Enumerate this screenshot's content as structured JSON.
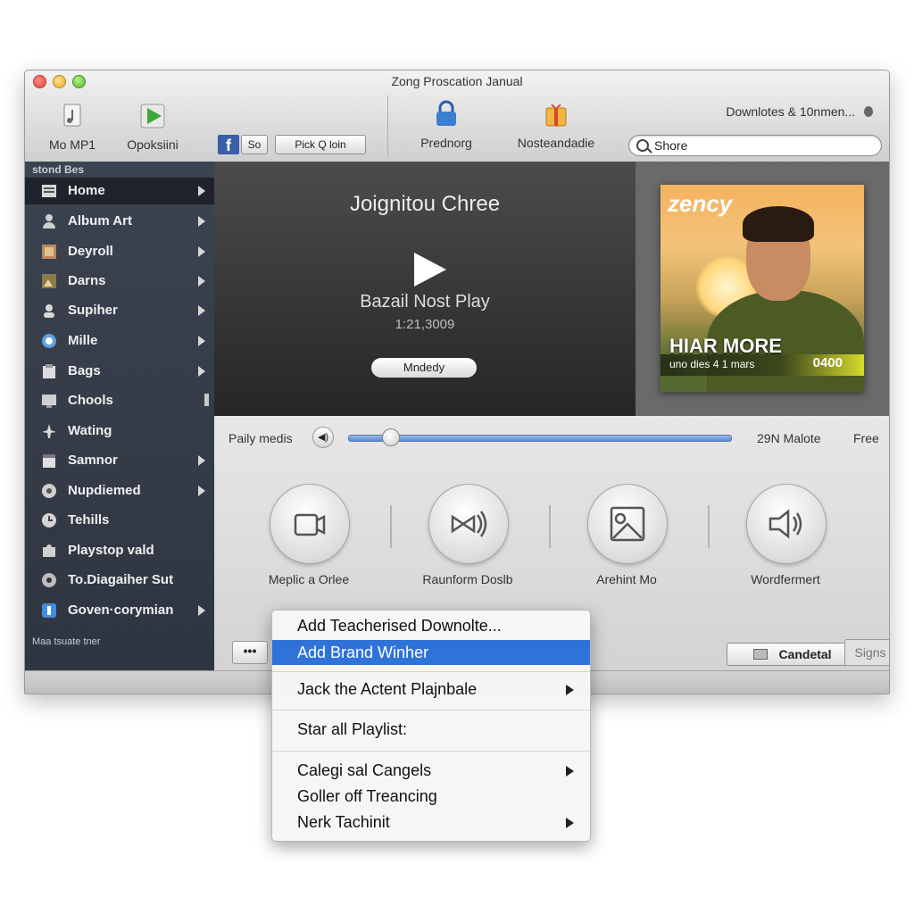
{
  "window": {
    "title": "Zong Proscation Janual"
  },
  "toolbar": {
    "left_items": [
      {
        "label": "Mo MP1",
        "icon": "music-file-icon"
      },
      {
        "label": "Opoksiini",
        "icon": "play-arrow-icon"
      }
    ],
    "fb_label": "f",
    "so_button": "So",
    "pick_button": "Pick Q loin",
    "center_items": [
      {
        "label": "Prednorg",
        "icon": "lock-icon"
      },
      {
        "label": "Nosteandadie",
        "icon": "gift-icon"
      }
    ],
    "downloads_label": "Downlotes & 10nmen...",
    "search_value": "Shore"
  },
  "sidebar": {
    "header": "stond Bes",
    "items": [
      {
        "label": "Home",
        "arrow": true,
        "active": true
      },
      {
        "label": "Album Art",
        "arrow": true
      },
      {
        "label": "Deyroll",
        "arrow": true
      },
      {
        "label": "Darns",
        "arrow": true
      },
      {
        "label": "Supiher",
        "arrow": true
      },
      {
        "label": "Mille",
        "arrow": true
      },
      {
        "label": "Bags",
        "arrow": true
      },
      {
        "label": "Chools",
        "arrow": false
      },
      {
        "label": "Wating",
        "arrow": false
      },
      {
        "label": "Samnor",
        "arrow": true
      },
      {
        "label": "Nupdiemed",
        "arrow": true
      },
      {
        "label": "Tehills",
        "arrow": false
      },
      {
        "label": "Playstop vald",
        "arrow": false
      },
      {
        "label": "To.Diagaiher Sut",
        "arrow": false
      },
      {
        "label": "Goven·corymian",
        "arrow": true
      }
    ],
    "footer": "Maa tsuate tner"
  },
  "player": {
    "title": "Joignitou Chree",
    "subtitle": "Bazail Nost Play",
    "time": "1:21,3009",
    "button": "Mndedy"
  },
  "album": {
    "brand": "zency",
    "headline": "HIAR MORE",
    "subline": "uno dies 4 1 mars",
    "price": "0400"
  },
  "playback": {
    "label": "Paily medis",
    "volume_icon": "speaker-icon",
    "progress": 0.11,
    "right_text": "29N Malote",
    "right_text2": "Free"
  },
  "actions": [
    {
      "label": "Meplic a Orlee",
      "icon": "camera-icon"
    },
    {
      "label": "Raunform Doslb",
      "icon": "sound-wave-icon"
    },
    {
      "label": "Arehint Mo",
      "icon": "image-frame-icon"
    },
    {
      "label": "Wordfermert",
      "icon": "speaker-icon"
    }
  ],
  "bottom": {
    "dots": "•••",
    "cancel_button": "Candetal",
    "signs_button": "Signs"
  },
  "context_menu": {
    "items": [
      {
        "label": "Add Teacherised Downolte...",
        "submenu": false,
        "selected": false
      },
      {
        "label": "Add Brand Winher",
        "submenu": false,
        "selected": true
      },
      {
        "label": "Jack the Actent Plajnbale",
        "submenu": true,
        "selected": false
      },
      {
        "label": "Star all Playlist:",
        "submenu": false,
        "selected": false
      },
      {
        "label": "Calegi sal Cangels",
        "submenu": true,
        "selected": false
      },
      {
        "label": "Goller off Treancing",
        "submenu": false,
        "selected": false
      },
      {
        "label": "Nerk Tachinit",
        "submenu": true,
        "selected": false
      }
    ]
  },
  "colors": {
    "accent": "#2f73d9",
    "sidebar": "#353b46",
    "player_bg": "#3a3a3b"
  }
}
